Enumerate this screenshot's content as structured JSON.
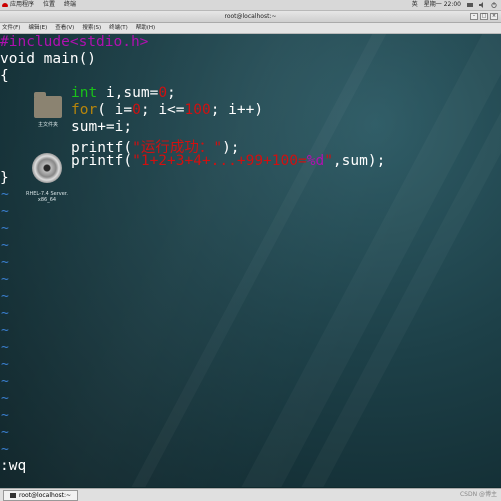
{
  "top_panel": {
    "applications": "应用程序",
    "places": "位置",
    "terminal": "终端",
    "language": "英",
    "clock": "星期一 22:00"
  },
  "window": {
    "title": "root@localhost:~",
    "menu": [
      "文件(F)",
      "编辑(E)",
      "查看(V)",
      "搜索(S)",
      "终端(T)",
      "帮助(H)"
    ]
  },
  "desktop_icons": [
    {
      "label": "主文件夹",
      "icon": "home-folder-icon"
    },
    {
      "label": "RHEL-7.4 Server.\nx86_64",
      "icon": "disc-icon"
    }
  ],
  "code": {
    "line1": {
      "hash": "#include",
      "header": "<stdio.h>"
    },
    "line2": "void main()",
    "line3": "{",
    "line4": {
      "type": "int",
      "rest1": " i,sum=",
      "zero": "0",
      "semi": ";"
    },
    "line5": {
      "for": "for",
      "p1": "( i=",
      "zero": "0",
      "p2": "; i<=",
      "hundred": "100",
      "p3": "; i++)"
    },
    "line6": "sum+=i;",
    "line7": {
      "fn": "printf(",
      "str": "\"运行成功：\"",
      "end": ");"
    },
    "line8": {
      "fn": "printf(",
      "str1": "\"1+2+3+4+...+99+100=",
      "fmt": "%d",
      "str2": "\"",
      "end": ",sum);"
    },
    "line9": "}"
  },
  "tilde_char": "~",
  "command_line": ":wq",
  "taskbar": {
    "task_label": "root@localhost:~",
    "watermark": "CSDN @博主"
  },
  "colors": {
    "type_keyword": "#19c219",
    "control_keyword": "#b8860b",
    "preprocessor": "#b010b0",
    "literal": "#d01010",
    "tilde": "#3a7fd0"
  }
}
